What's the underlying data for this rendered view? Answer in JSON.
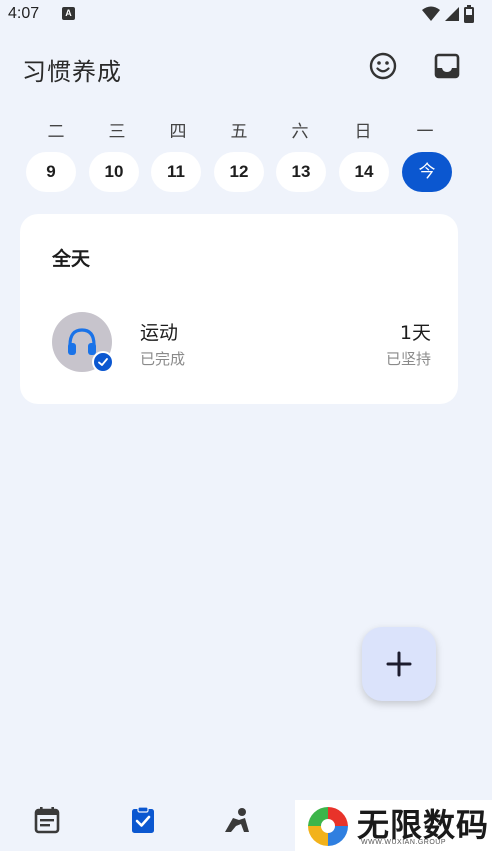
{
  "status_bar": {
    "time": "4:07",
    "notification_glyph": "A",
    "icons": [
      "wifi-icon",
      "cellular-signal-icon",
      "battery-icon"
    ]
  },
  "header": {
    "title": "习惯养成",
    "actions": [
      "smiley-icon",
      "inbox-icon"
    ]
  },
  "week": {
    "weekdays": [
      "二",
      "三",
      "四",
      "五",
      "六",
      "日",
      "一"
    ],
    "dates": [
      "9",
      "10",
      "11",
      "12",
      "13",
      "14",
      "今"
    ],
    "selected_index": 6
  },
  "card": {
    "section_title": "全天",
    "habit": {
      "icon": "headphones-icon",
      "name": "运动",
      "status": "已完成",
      "streak_value": "1天",
      "streak_label": "已坚持"
    }
  },
  "fab": {
    "icon": "plus-icon"
  },
  "bottom_nav": {
    "items": [
      "calendar-icon",
      "clipboard-check-icon",
      "person-activity-icon"
    ],
    "active_index": 1
  },
  "watermark": {
    "text": "无限数码",
    "subtext": "WWW.WUXIAN.GROUP"
  },
  "colors": {
    "accent": "#0b57d0",
    "background": "#eff3fb",
    "card": "#ffffff",
    "fab": "#dbe3fb"
  }
}
